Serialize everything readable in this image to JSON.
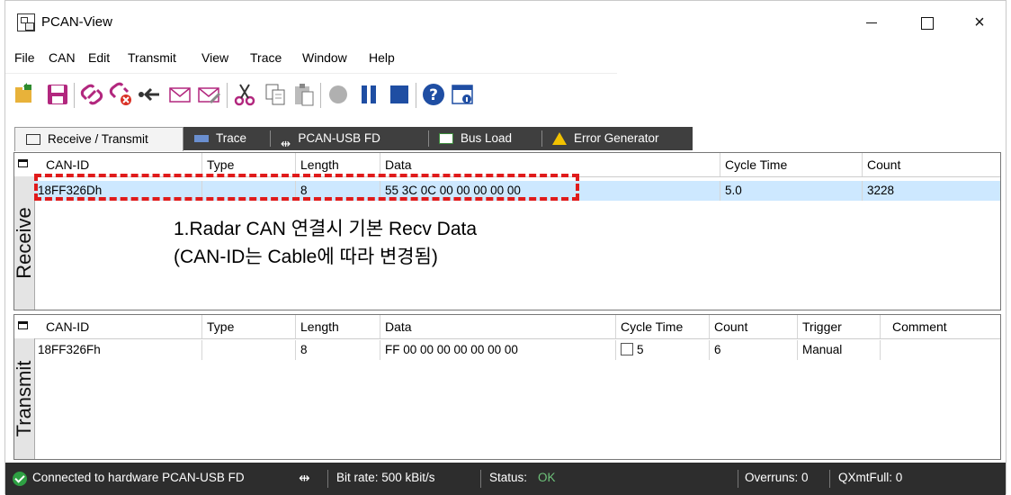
{
  "window": {
    "title": "PCAN-View",
    "minimize": "",
    "maximize": "",
    "close": "×"
  },
  "menu": [
    "File",
    "CAN",
    "Edit",
    "Transmit",
    "View",
    "Trace",
    "Window",
    "Help"
  ],
  "toolbar_icons": [
    "connect-open-icon",
    "save-icon",
    "connect-icon",
    "disconnect-icon",
    "transmit-icon",
    "message-new-icon",
    "message-edit-icon",
    "cut-icon",
    "copy-icon",
    "paste-icon",
    "record-icon",
    "pause-icon",
    "stop-icon",
    "help-icon",
    "info-icon"
  ],
  "tabs": [
    {
      "label": "Receive / Transmit",
      "icon": "receive-transmit-icon",
      "active": true
    },
    {
      "label": "Trace",
      "icon": "trace-icon",
      "active": false
    },
    {
      "label": "PCAN-USB FD",
      "icon": "usb-icon",
      "active": false
    },
    {
      "label": "Bus Load",
      "icon": "bus-load-icon",
      "active": false
    },
    {
      "label": "Error Generator",
      "icon": "warning-icon",
      "active": false
    }
  ],
  "receive": {
    "side_label": "Receive",
    "headers": [
      "CAN-ID",
      "Type",
      "Length",
      "Data",
      "Cycle Time",
      "Count"
    ],
    "rows": [
      {
        "can_id": "18FF326Dh",
        "type": "",
        "length": "8",
        "data": "55 3C 0C 00 00 00 00 00",
        "cycle_time": "5.0",
        "count": "3228"
      }
    ]
  },
  "transmit": {
    "side_label": "Transmit",
    "headers": [
      "CAN-ID",
      "Type",
      "Length",
      "Data",
      "Cycle Time",
      "Count",
      "Trigger",
      "Comment"
    ],
    "rows": [
      {
        "can_id": "18FF326Fh",
        "type": "",
        "length": "8",
        "data": "FF 00 00 00 00 00 00 00",
        "cycle_time": "5",
        "count": "6",
        "trigger": "Manual",
        "comment": ""
      }
    ]
  },
  "annotation": {
    "line1": "1.Radar CAN 연결시 기본 Recv Data",
    "line2": "(CAN-ID는 Cable에 따라 변경됨)",
    "color": "#e01b1b"
  },
  "status": {
    "connection": "Connected to hardware PCAN-USB FD",
    "bitrate": "Bit rate: 500 kBit/s",
    "status_label": "Status:",
    "status_value": "OK",
    "overruns": "Overruns: 0",
    "qxmtfull": "QXmtFull: 0",
    "ok_color": "#2ea043"
  }
}
